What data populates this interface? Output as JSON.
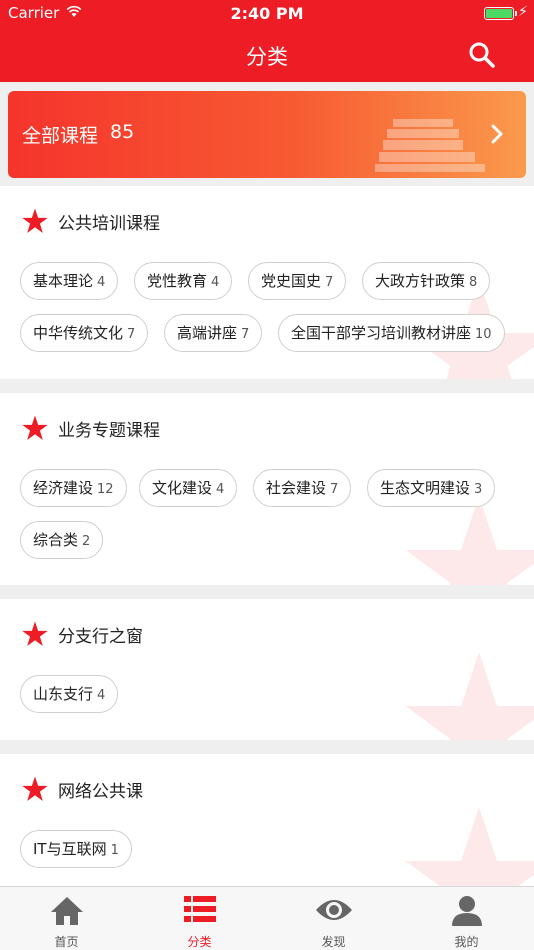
{
  "status": {
    "carrier": "Carrier",
    "time": "2:40 PM"
  },
  "nav": {
    "title": "分类"
  },
  "all_courses": {
    "label": "全部课程",
    "count": "85"
  },
  "sections": [
    {
      "title": "公共培训课程",
      "tags": [
        {
          "name": "基本理论",
          "count": "4"
        },
        {
          "name": "党性教育",
          "count": "4"
        },
        {
          "name": "党史国史",
          "count": "7"
        },
        {
          "name": "大政方针政策",
          "count": "8"
        },
        {
          "name": "中华传统文化",
          "count": "7"
        },
        {
          "name": "高端讲座",
          "count": "7"
        },
        {
          "name": "全国干部学习培训教材讲座",
          "count": "10"
        }
      ]
    },
    {
      "title": "业务专题课程",
      "tags": [
        {
          "name": "经济建设",
          "count": "12"
        },
        {
          "name": "文化建设",
          "count": "4"
        },
        {
          "name": "社会建设",
          "count": "7"
        },
        {
          "name": "生态文明建设",
          "count": "3"
        },
        {
          "name": "综合类",
          "count": "2"
        }
      ]
    },
    {
      "title": "分支行之窗",
      "tags": [
        {
          "name": "山东支行",
          "count": "4"
        }
      ]
    },
    {
      "title": "网络公共课",
      "tags": [
        {
          "name": "IT与互联网",
          "count": "1"
        }
      ]
    }
  ],
  "tabbar": [
    {
      "label": "首页",
      "icon": "home-icon"
    },
    {
      "label": "分类",
      "icon": "category-list-icon"
    },
    {
      "label": "发现",
      "icon": "eye-icon"
    },
    {
      "label": "我的",
      "icon": "user-icon"
    }
  ],
  "colors": {
    "brand_red": "#ee1c25",
    "battery_green": "#4cd964"
  }
}
